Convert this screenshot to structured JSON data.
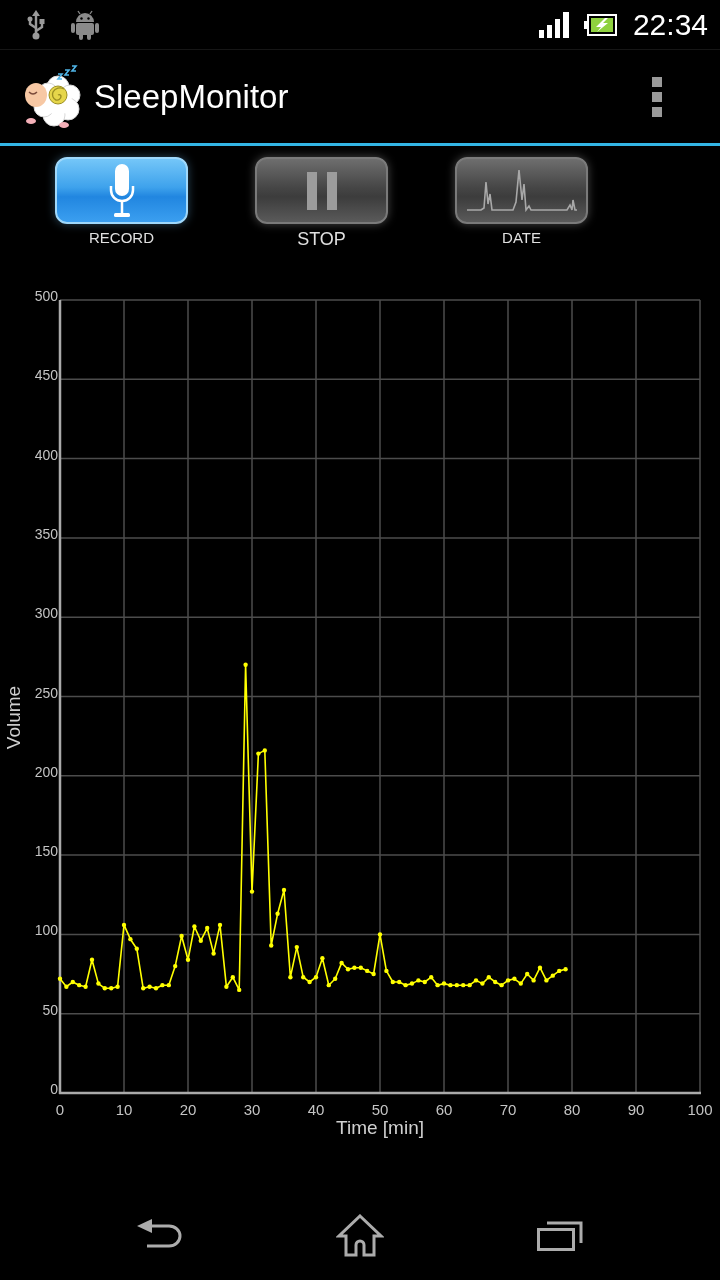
{
  "status_bar": {
    "time": "22:34"
  },
  "app_bar": {
    "title": "SleepMonitor"
  },
  "buttons": [
    {
      "label": "RECORD",
      "kind": "record",
      "selected": true
    },
    {
      "label": "STOP",
      "kind": "stop",
      "selected": false
    },
    {
      "label": "DATE",
      "kind": "date",
      "selected": false
    }
  ],
  "chart": {
    "chart_data": {
      "type": "line",
      "xlabel": "Time [min]",
      "ylabel": "Volume",
      "grid": true,
      "x": [
        0,
        1,
        2,
        3,
        4,
        5,
        6,
        7,
        8,
        9,
        10,
        11,
        12,
        13,
        14,
        15,
        16,
        17,
        18,
        19,
        20,
        21,
        22,
        23,
        24,
        25,
        26,
        27,
        28,
        29,
        30,
        31,
        32,
        33,
        34,
        35,
        36,
        37,
        38,
        39,
        40,
        41,
        42,
        43,
        44,
        45,
        46,
        47,
        48,
        49,
        50,
        51,
        52,
        53,
        54,
        55,
        56,
        57,
        58,
        59,
        60,
        61,
        62,
        63,
        64,
        65,
        66,
        67,
        68,
        69,
        70,
        71,
        72,
        73,
        74,
        75,
        76,
        77,
        78,
        79
      ],
      "series": [
        {
          "color": "#ffff00",
          "values": [
            72,
            67,
            70,
            68,
            67,
            84,
            69,
            66,
            66,
            67,
            106,
            97,
            91,
            66,
            67,
            66,
            68,
            68,
            80,
            99,
            84,
            105,
            96,
            104,
            88,
            106,
            67,
            73,
            65,
            270,
            127,
            214,
            216,
            93,
            113,
            128,
            73,
            92,
            73,
            70,
            73,
            85,
            68,
            72,
            82,
            78,
            79,
            79,
            77,
            75,
            100,
            77,
            70,
            70,
            68,
            69,
            71,
            70,
            73,
            68,
            69,
            68,
            68,
            68,
            68,
            71,
            69,
            73,
            70,
            68,
            71,
            72,
            69,
            75,
            71,
            79,
            71,
            74,
            77,
            78
          ]
        }
      ],
      "xlim": [
        0,
        100
      ],
      "ylim": [
        0,
        500
      ],
      "xticks": [
        0,
        10,
        20,
        30,
        40,
        50,
        60,
        70,
        80,
        90,
        100
      ],
      "yticks": [
        0,
        50,
        100,
        150,
        200,
        250,
        300,
        350,
        400,
        450,
        500
      ]
    }
  }
}
